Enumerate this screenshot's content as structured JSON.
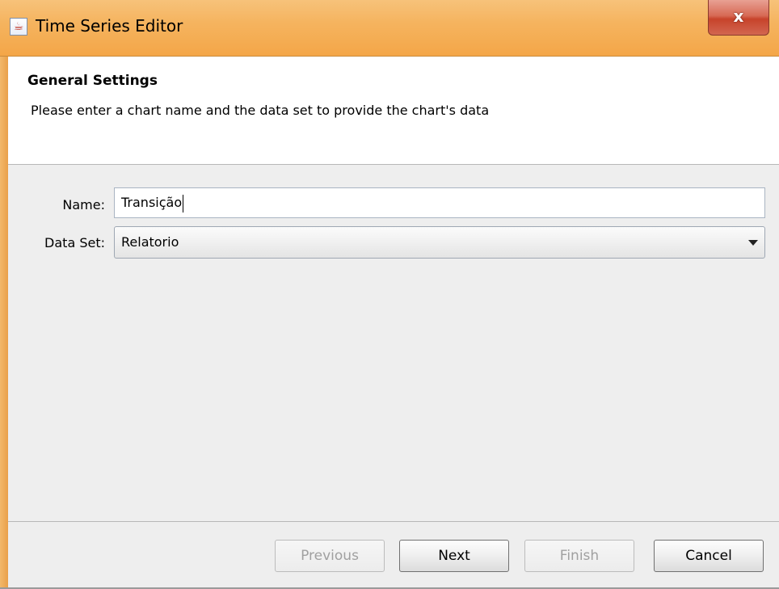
{
  "window": {
    "title": "Time Series Editor",
    "close_label": "x",
    "app_icon": "java-coffee-icon"
  },
  "header": {
    "title": "General Settings",
    "description": "Please enter a chart name and the data set to provide the chart's data"
  },
  "form": {
    "name_label": "Name:",
    "name_value": "Transição",
    "dataset_label": "Data Set:",
    "dataset_value": "Relatorio"
  },
  "buttons": {
    "previous": "Previous",
    "next": "Next",
    "finish": "Finish",
    "cancel": "Cancel"
  },
  "states": {
    "previous_enabled": false,
    "next_enabled": true,
    "finish_enabled": false,
    "cancel_enabled": true
  }
}
